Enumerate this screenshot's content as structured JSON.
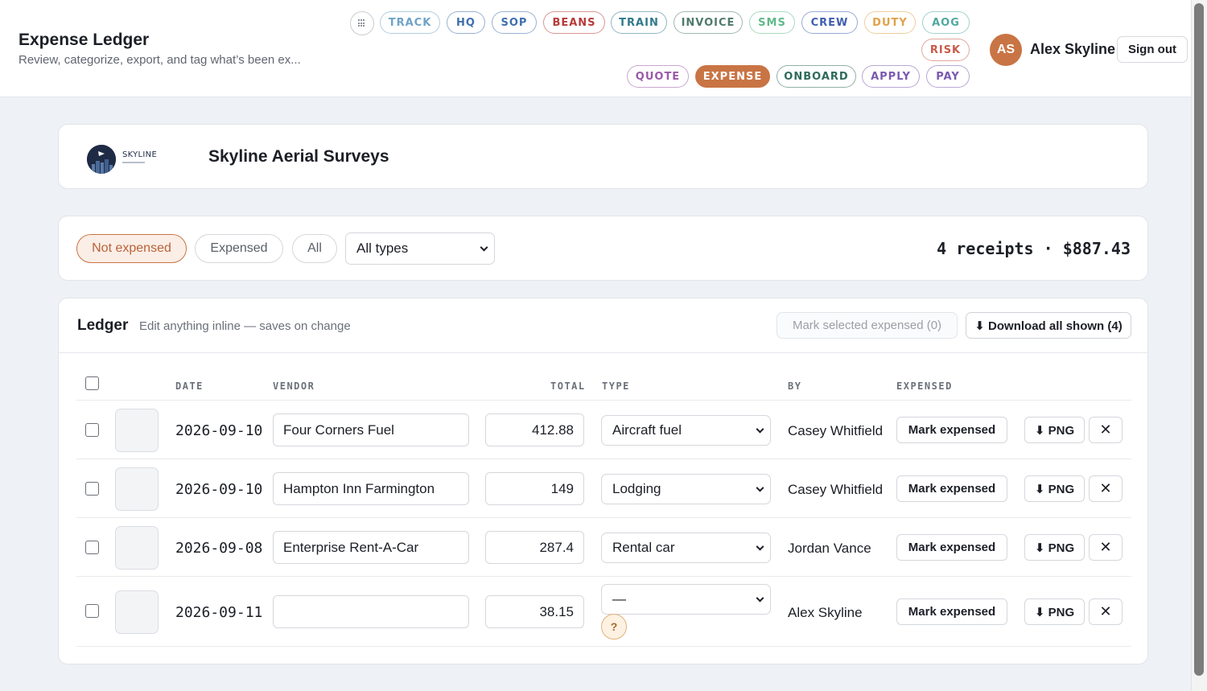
{
  "header": {
    "title": "Expense Ledger",
    "subtitle": "Review, categorize, export, and tag what’s been ex...",
    "grid_icon": "grid-icon",
    "nav": [
      {
        "label": "TRACK",
        "color": "#6fa3c7"
      },
      {
        "label": "HQ",
        "color": "#3f6fae"
      },
      {
        "label": "SOP",
        "color": "#3f6fae"
      },
      {
        "label": "BEANS",
        "color": "#b83a3a"
      },
      {
        "label": "TRAIN",
        "color": "#2f7a8a"
      },
      {
        "label": "INVOICE",
        "color": "#4f7a6a"
      },
      {
        "label": "SMS",
        "color": "#5fb98a"
      },
      {
        "label": "CREW",
        "color": "#3f5fae"
      },
      {
        "label": "DUTY",
        "color": "#e0a24a"
      },
      {
        "label": "AOG",
        "color": "#4fa8a0"
      },
      {
        "label": "RISK",
        "color": "#c95a4a"
      },
      {
        "label": "QUOTE",
        "color": "#9a5aa8"
      },
      {
        "label": "EXPENSE",
        "color": "#c97444",
        "active": true
      },
      {
        "label": "ONBOARD",
        "color": "#2f6a5a"
      },
      {
        "label": "APPLY",
        "color": "#7a5ab0"
      },
      {
        "label": "PAY",
        "color": "#7a5ab0"
      }
    ],
    "user": {
      "initials": "AS",
      "name": "Alex Skyline",
      "signout": "Sign out"
    }
  },
  "company": {
    "logo_text": "SKYLINE",
    "name": "Skyline Aerial Surveys"
  },
  "filters": {
    "not_expensed": "Not expensed",
    "expensed": "Expensed",
    "all": "All",
    "type_select": "All types",
    "summary": "4 receipts · $887.43"
  },
  "ledger": {
    "title": "Ledger",
    "hint": "Edit anything inline — saves on change",
    "mark_selected": "Mark selected expensed (0)",
    "download_all": "⬇ Download all shown (4)",
    "columns": {
      "date": "DATE",
      "vendor": "VENDOR",
      "total": "TOTAL",
      "type": "TYPE",
      "by": "BY",
      "expensed": "EXPENSED"
    },
    "rows": [
      {
        "date": "2026-09-10",
        "vendor": "Four Corners Fuel",
        "total": "412.88",
        "type": "Aircraft fuel",
        "by": "Casey Whitfield",
        "mark": "Mark expensed",
        "png": "⬇ PNG",
        "remove": "✕"
      },
      {
        "date": "2026-09-10",
        "vendor": "Hampton Inn Farmington",
        "total": "149",
        "type": "Lodging",
        "by": "Casey Whitfield",
        "mark": "Mark expensed",
        "png": "⬇ PNG",
        "remove": "✕"
      },
      {
        "date": "2026-09-08",
        "vendor": "Enterprise Rent-A-Car",
        "total": "287.4",
        "type": "Rental car",
        "by": "Jordan Vance",
        "mark": "Mark expensed",
        "png": "⬇ PNG",
        "remove": "✕"
      },
      {
        "date": "2026-09-11",
        "vendor": "",
        "total": "38.15",
        "type": "—",
        "by": "Alex Skyline",
        "mark": "Mark expensed",
        "png": "⬇ PNG",
        "remove": "✕",
        "flag": "?"
      }
    ]
  }
}
